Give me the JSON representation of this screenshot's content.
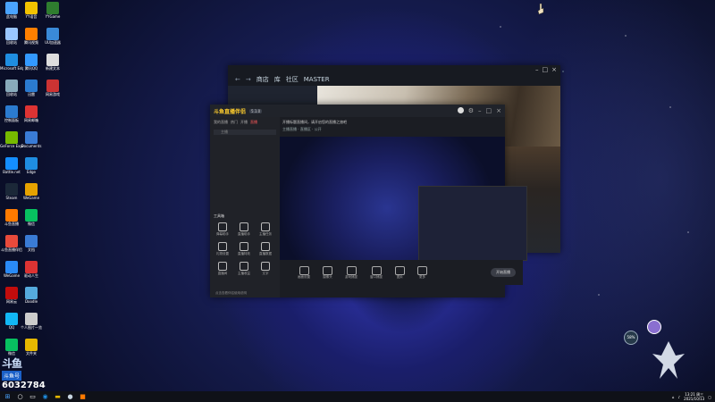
{
  "desktop": {
    "icons_col1": [
      {
        "label": "此电脑",
        "color": "#4aa3ff"
      },
      {
        "label": "回收站",
        "color": "#9ac6ff"
      },
      {
        "label": "Microsoft Edge",
        "color": "#1f8de0"
      },
      {
        "label": "回收站",
        "color": "#8ab"
      },
      {
        "label": "控制面板",
        "color": "#2b7bd0"
      },
      {
        "label": "GeForce Experience",
        "color": "#76b900"
      },
      {
        "label": "Battle.net",
        "color": "#148eff"
      },
      {
        "label": "Steam",
        "color": "#1b2838"
      },
      {
        "label": "斗鱼直播",
        "color": "#ff7a00"
      },
      {
        "label": "斗鱼直播伴侣",
        "color": "#e84a3b"
      },
      {
        "label": "WeGame",
        "color": "#2a8af7"
      },
      {
        "label": "网易云",
        "color": "#c20c0c"
      },
      {
        "label": "QQ",
        "color": "#12b7f5"
      },
      {
        "label": "微信",
        "color": "#07c160"
      }
    ],
    "icons_col2": [
      {
        "label": "YY语音",
        "color": "#f3c300"
      },
      {
        "label": "腾讯视频",
        "color": "#ff7f00"
      },
      {
        "label": "腾讯QQ",
        "color": "#3399ff"
      },
      {
        "label": "迅雷",
        "color": "#2b7bd0"
      },
      {
        "label": "网易邮箱",
        "color": "#d33"
      },
      {
        "label": "Documents",
        "color": "#3a7bd5"
      },
      {
        "label": "Edge",
        "color": "#1f8de0"
      },
      {
        "label": "WeGame",
        "color": "#e6a200"
      },
      {
        "label": "微信",
        "color": "#07c160"
      },
      {
        "label": "文档",
        "color": "#3a7bd5"
      },
      {
        "label": "驱动人生",
        "color": "#d33"
      },
      {
        "label": "Doodle",
        "color": "#5ad"
      },
      {
        "label": "个人图片一览",
        "color": "#ccc"
      },
      {
        "label": "文件夹",
        "color": "#e6b800"
      }
    ],
    "icons_col3": [
      {
        "label": "YYGame",
        "color": "#2f7d2f"
      },
      {
        "label": "UU加速器",
        "color": "#3a8ad8"
      },
      {
        "label": "新建文本",
        "color": "#ddd"
      },
      {
        "label": "网易游戏",
        "color": "#c33"
      }
    ]
  },
  "steam_window": {
    "nav": [
      "商店",
      "库",
      "社区",
      "MASTER"
    ]
  },
  "douyu_window": {
    "logo": "斗鱼直播伴侣",
    "version": "5.1.0",
    "tabs": [
      "我的直播",
      "热门",
      "开播",
      "直播"
    ],
    "search_placeholder": "主播",
    "tools_title": "工具箱",
    "tools": [
      {
        "label": "弹幕助手"
      },
      {
        "label": "直播助手"
      },
      {
        "label": "主播任务"
      },
      {
        "label": "礼物设置"
      },
      {
        "label": "直播特效"
      },
      {
        "label": "直播数据"
      },
      {
        "label": "直播间"
      },
      {
        "label": "主播收益"
      },
      {
        "label": "文字"
      }
    ],
    "footer_tip": "点击查看伴侣使用说明",
    "info_line1": "开播标题直播间，请开启您的直播之旅吧",
    "info_line2": "主播直播 · 直播区 · 公开",
    "bottom_tools": [
      {
        "label": "画面设置"
      },
      {
        "label": "摄像头"
      },
      {
        "label": "游戏捕捉"
      },
      {
        "label": "窗口捕捉"
      },
      {
        "label": "图片"
      },
      {
        "label": "更多"
      }
    ],
    "start_button": "开始直播"
  },
  "watermark": {
    "logo": "斗鱼",
    "name": "斗鱼号",
    "room_id": "6032784"
  },
  "widget": {
    "percent": "58%"
  },
  "taskbar": {
    "time": "13:21 周三",
    "date": "2021/10/13"
  }
}
